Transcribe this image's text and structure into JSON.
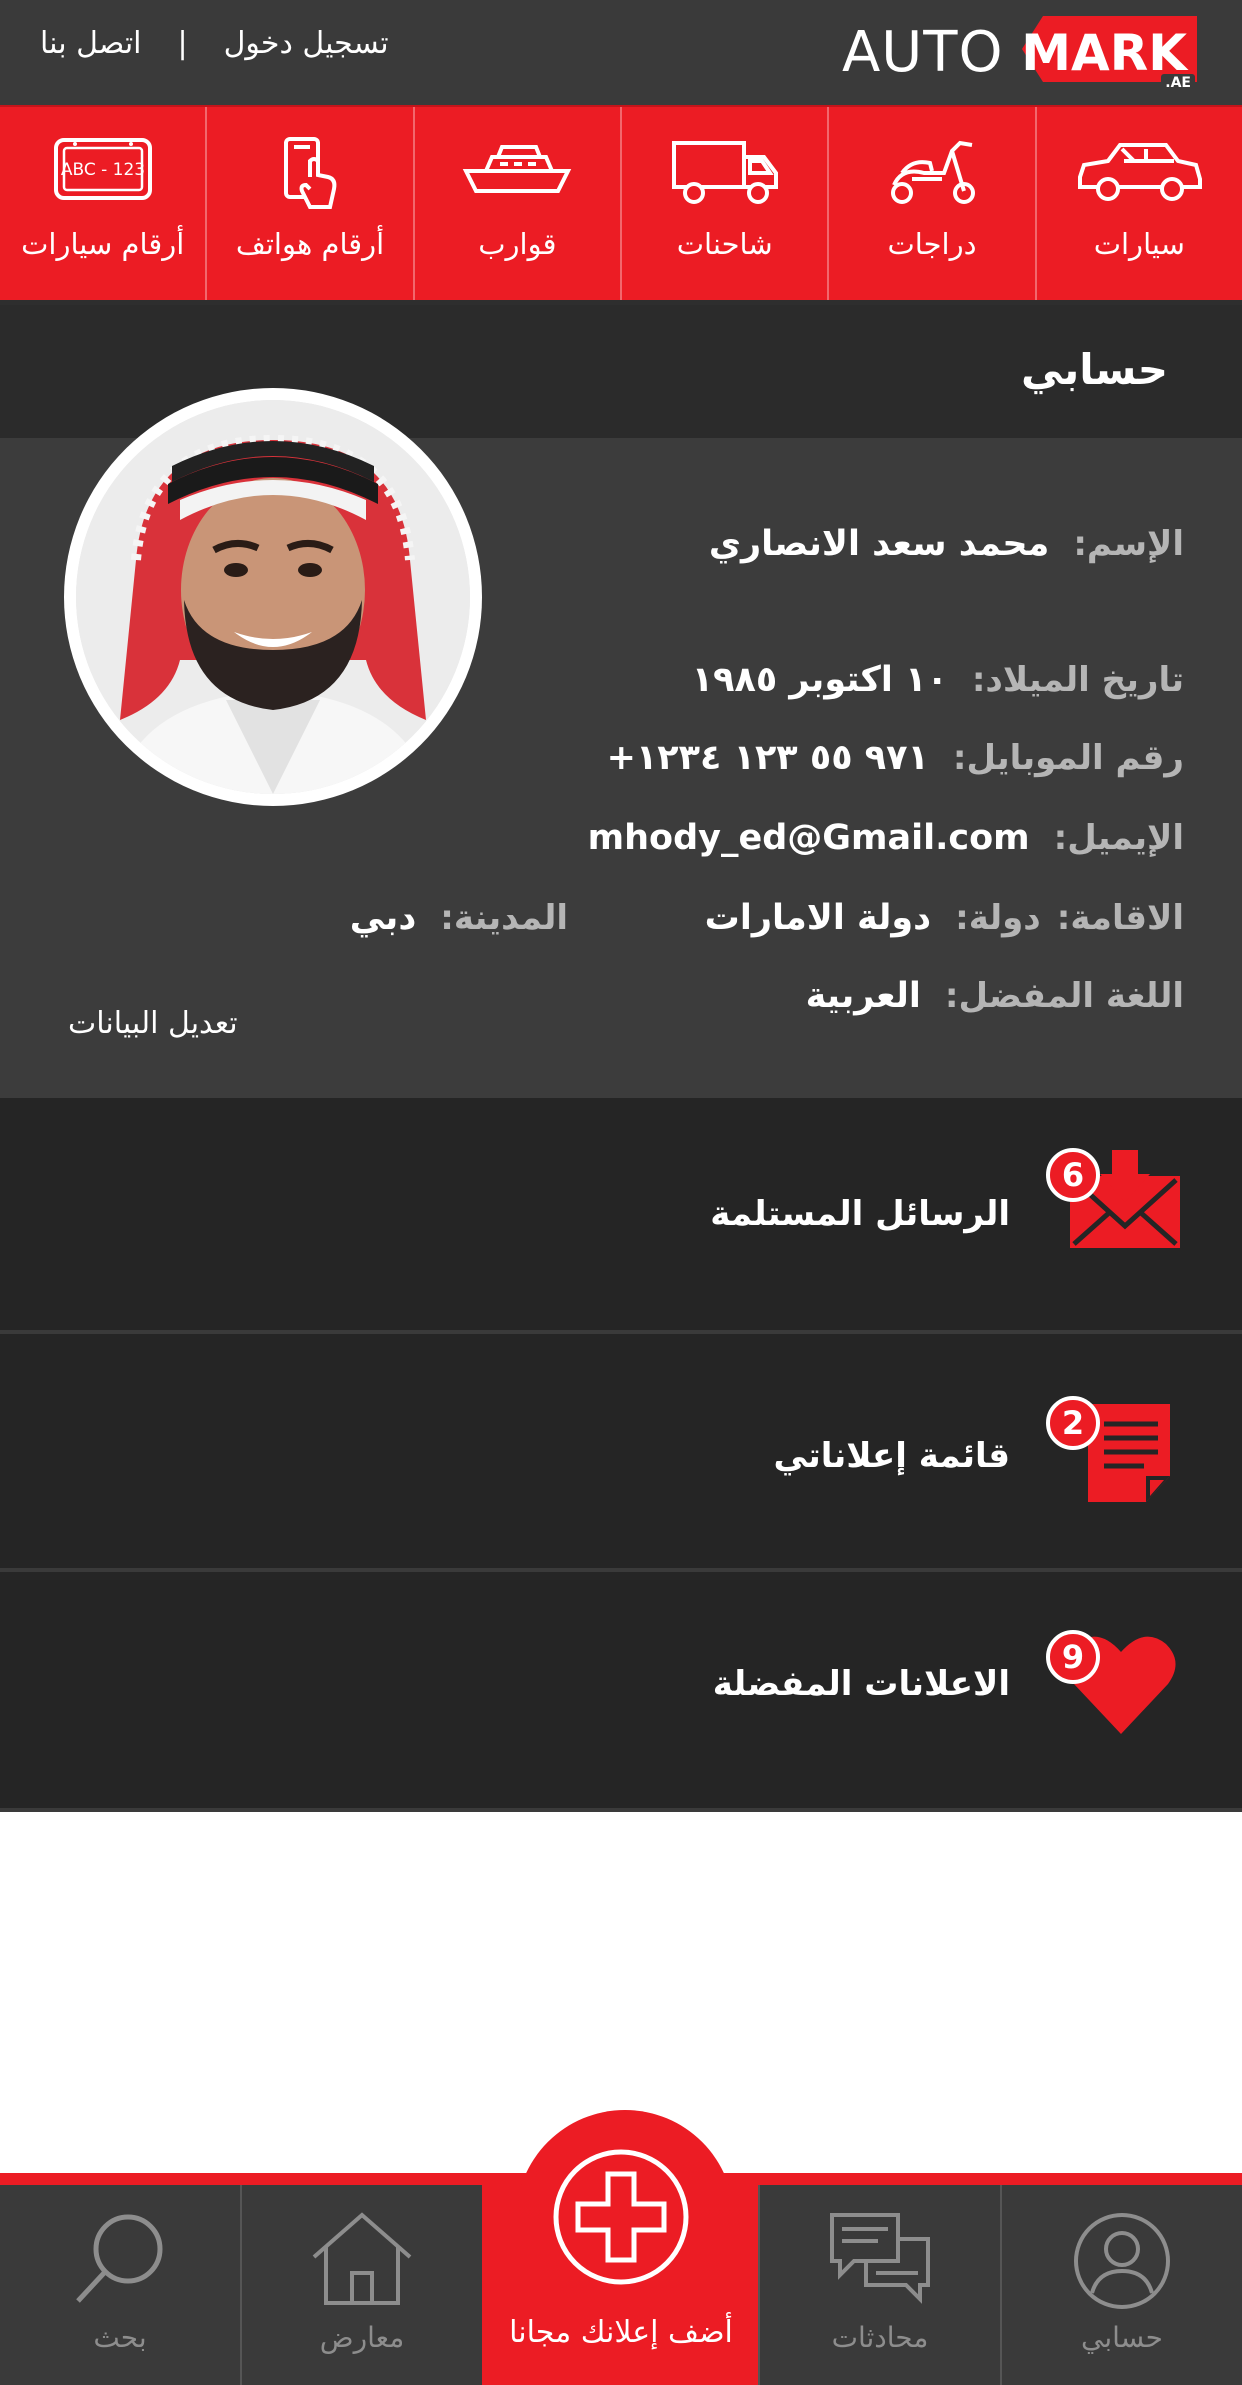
{
  "header": {
    "logo_auto": "AUTO",
    "logo_mark": "MARK",
    "logo_ae": ".AE",
    "login_label": "تسجيل دخول",
    "separator": "|",
    "contact_label": "اتصل بنا"
  },
  "categories": [
    {
      "label": "سيارات",
      "icon": "car-icon"
    },
    {
      "label": "دراجات",
      "icon": "scooter-icon"
    },
    {
      "label": "شاحنات",
      "icon": "truck-icon"
    },
    {
      "label": "قوارب",
      "icon": "boat-icon"
    },
    {
      "label": "أرقام هواتف",
      "icon": "phone-touch-icon"
    },
    {
      "label": "أرقام سيارات",
      "icon": "license-plate-icon",
      "plate_text": "ABC - 123"
    }
  ],
  "profile": {
    "title": "حسابي",
    "name_label": "الإسم:",
    "name_value": "محمد سعد الانصاري",
    "birth_label": "تاريخ الميلاد:",
    "birth_value": "١٠ اكتوبر ١٩٨٥",
    "mobile_label": "رقم الموبايل:",
    "mobile_value": "+٩٧١ ٥٥ ١٢٣ ١٢٣٤",
    "email_label": "الإيميل:",
    "email_value": "mhody_ed@Gmail.com",
    "residence_label": "الاقامة:",
    "country_label": "دولة:",
    "country_value": "دولة الامارات",
    "city_label": "المدينة:",
    "city_value": "دبي",
    "language_label": "اللغة المفضل:",
    "language_value": "العربية",
    "edit_label": "تعديل البيانات"
  },
  "menu": [
    {
      "label": "الرسائل المستلمة",
      "badge": "6",
      "icon": "inbox-envelope-icon"
    },
    {
      "label": "قائمة إعلاناتي",
      "badge": "2",
      "icon": "document-list-icon"
    },
    {
      "label": "الاعلانات المفضلة",
      "badge": "9",
      "icon": "heart-icon"
    }
  ],
  "bottom_nav": {
    "account": "حسابي",
    "chats": "محادثات",
    "add": "أضف إعلانك مجانا",
    "showrooms": "معارض",
    "search": "بحث"
  },
  "colors": {
    "brand_red": "#ec1c24",
    "header_dark": "#3a3a3a",
    "panel_dark": "#252525"
  }
}
